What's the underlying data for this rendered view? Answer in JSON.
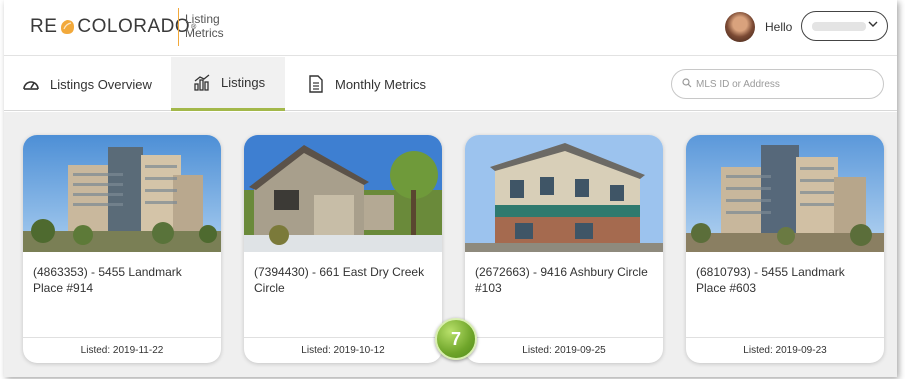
{
  "header": {
    "logo_left": "RE",
    "logo_right": "COLORADO",
    "logo_reg": "®",
    "app_title_line1": "Listing",
    "app_title_line2": "Metrics",
    "greeting": "Hello",
    "user_menu_value": ""
  },
  "tabs": [
    {
      "label": "Listings Overview",
      "icon": "gauge-icon",
      "active": false
    },
    {
      "label": "Listings",
      "icon": "bar-chart-icon",
      "active": true
    },
    {
      "label": "Monthly Metrics",
      "icon": "document-icon",
      "active": false
    }
  ],
  "search": {
    "placeholder": "MLS ID or Address"
  },
  "listings": [
    {
      "title": "(4863353) - 5455 Landmark Place #914",
      "listed": "Listed: 2019-11-22"
    },
    {
      "title": "(7394430) - 661 East Dry Creek Circle",
      "listed": "Listed: 2019-10-12"
    },
    {
      "title": "(2672663) - 9416 Ashbury Circle #103",
      "listed": "Listed: 2019-09-25"
    },
    {
      "title": "(6810793) - 5455 Landmark Place #603",
      "listed": "Listed: 2019-09-23"
    }
  ],
  "callout_badge": "7",
  "colors": {
    "accent": "#a3b84a",
    "logo_drop": "#f2a93b",
    "badge": "#6fa52a"
  }
}
